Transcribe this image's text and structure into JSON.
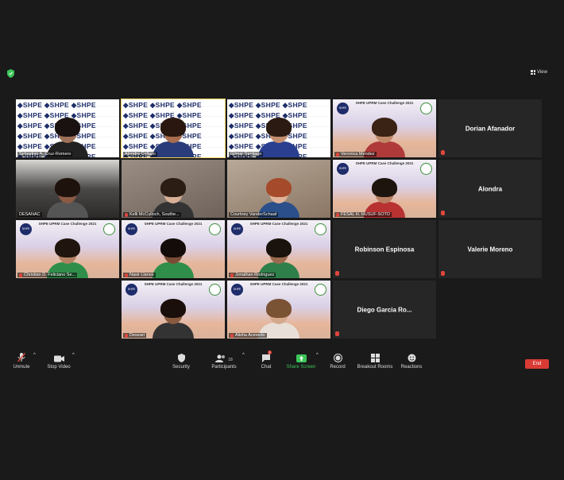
{
  "top": {
    "view_label": "View"
  },
  "tiles": [
    {
      "name": "Sebastian A. Cruz-Romero",
      "bg": "shpe",
      "skin": "#a0715a",
      "hair": "#1a1210",
      "shirt": "#222",
      "muted": false
    },
    {
      "name": "Alondra Collazo",
      "bg": "shpe",
      "skin": "#a86c4e",
      "hair": "#2a1810",
      "shirt": "#2a3d7a",
      "muted": false,
      "active": true
    },
    {
      "name": "Gilmar Santiago",
      "bg": "shpe",
      "skin": "#c48f70",
      "hair": "#2a1a12",
      "shirt": "#2a3f8f",
      "muted": false
    },
    {
      "name": "Veronica Mendez",
      "bg": "challenge",
      "skin": "#c08a6a",
      "hair": "#3a2214",
      "shirt": "#b03a3a",
      "muted": true
    },
    {
      "name": "Dorian Afanador",
      "bg": "none",
      "muted": true
    },
    {
      "name": "DESANAC",
      "bg": "dark",
      "skin": "#8a5a44",
      "hair": "#1e120c",
      "shirt": "#555",
      "muted": false
    },
    {
      "name": "Kelli McCulloch, Southe...",
      "bg": "room",
      "skin": "#d8b096",
      "hair": "#2b1c14",
      "shirt": "#333",
      "muted": true
    },
    {
      "name": "Courtney VanderSchaaf",
      "bg": "room2",
      "skin": "#e0b39a",
      "hair": "#a54a2a",
      "shirt": "#2a4f8a",
      "muted": false
    },
    {
      "name": "FESAL H. HUSUF-SOTO",
      "bg": "challenge",
      "skin": "#b98063",
      "hair": "#1e140e",
      "shirt": "#b83232",
      "muted": true
    },
    {
      "name": "Alondra",
      "bg": "none",
      "muted": true
    },
    {
      "name": "Christian D. Feliciano Se...",
      "bg": "challenge",
      "skin": "#b48264",
      "hair": "#1f140e",
      "shirt": "#2f8f4a",
      "muted": true
    },
    {
      "name": "Nasir Llanos",
      "bg": "challenge",
      "skin": "#7a4c35",
      "hair": "#140c08",
      "shirt": "#2f8f4a",
      "muted": true
    },
    {
      "name": "Jonathan Rodriguez",
      "bg": "challenge",
      "skin": "#9a6a4e",
      "hair": "#1a120c",
      "shirt": "#2f7f4a",
      "muted": true
    },
    {
      "name": "Robinson Espinosa",
      "bg": "none",
      "muted": true
    },
    {
      "name": "Valerie Moreno",
      "bg": "none",
      "muted": true
    },
    {
      "name": "Deseari",
      "bg": "challenge",
      "skin": "#8a5a40",
      "hair": "#1a0f0a",
      "shirt": "#333",
      "muted": true
    },
    {
      "name": "Alisha Acevedo",
      "bg": "challenge",
      "skin": "#d4a98c",
      "hair": "#7a5234",
      "shirt": "#e8e0d8",
      "muted": true
    },
    {
      "name": "Diego Garcia Ro...",
      "bg": "none",
      "muted": true
    }
  ],
  "challenge_title": "SHPE UPRM Case Challenge 2021",
  "shpe_logo_text": "SHPE",
  "toolbar": {
    "unmute": "Unmute",
    "stop_video": "Stop Video",
    "security": "Security",
    "participants": "Participants",
    "participants_count": "18",
    "chat": "Chat",
    "chat_badge": "1",
    "share_screen": "Share Screen",
    "record": "Record",
    "breakout": "Breakout Rooms",
    "reactions": "Reactions",
    "end": "End"
  },
  "colors": {
    "share_green": "#3cc55a",
    "end_red": "#d93b34",
    "active_border": "#f5d25b",
    "muted_red": "#e0463c"
  }
}
